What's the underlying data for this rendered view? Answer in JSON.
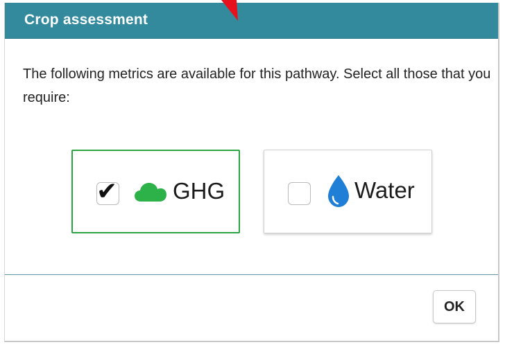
{
  "dialog": {
    "title": "Crop assessment",
    "prompt": "The following metrics are available for this pathway. Select all those that you require:",
    "options": [
      {
        "label": "GHG",
        "checked": true,
        "icon": "cloud-icon",
        "icon_color": "#2db24a",
        "border_color": "#2aa340"
      },
      {
        "label": "Water",
        "checked": false,
        "icon": "water-drop-icon",
        "icon_color": "#1f7fd6",
        "border_color": "#cfcfcf"
      }
    ],
    "ok_label": "OK",
    "check_glyph": "✔"
  },
  "colors": {
    "titlebar": "#338a9c",
    "pointer": "#e8101c"
  }
}
